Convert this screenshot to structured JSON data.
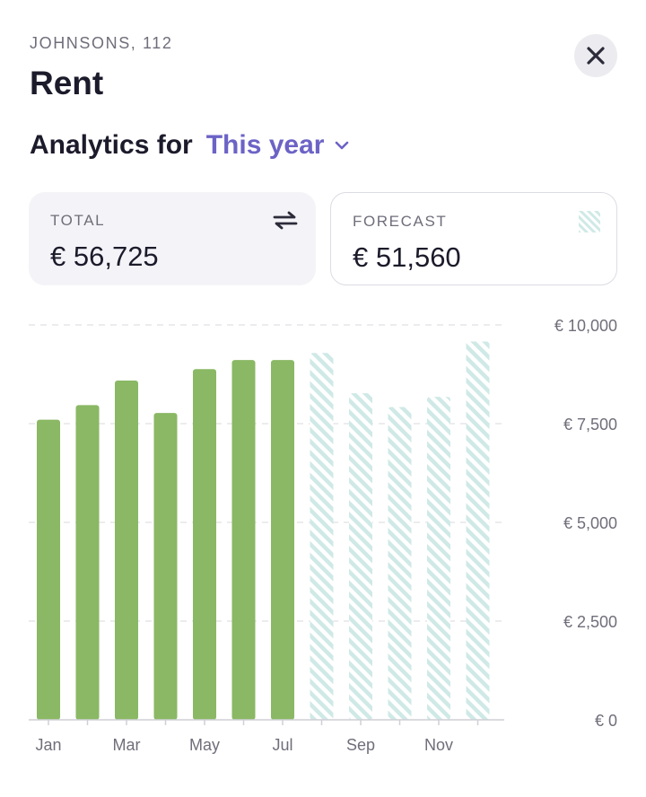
{
  "header": {
    "subtitle": "JOHNSONS, 112",
    "title": "Rent"
  },
  "analytics": {
    "label": "Analytics for",
    "period": "This year"
  },
  "cards": {
    "total": {
      "label": "TOTAL",
      "value": "€ 56,725"
    },
    "forecast": {
      "label": "FORECAST",
      "value": "€ 51,560"
    }
  },
  "colors": {
    "actual": "#8ab864",
    "forecast": "#cfe9e6",
    "accent": "#6c63c6"
  },
  "icons": {
    "close": "close-icon",
    "swap": "swap-arrows-icon",
    "forecast": "hatched-square-icon",
    "period": "chevron-down-icon"
  },
  "chart_data": {
    "type": "bar",
    "categories": [
      "Jan",
      "Feb",
      "Mar",
      "Apr",
      "May",
      "Jun",
      "Jul",
      "Aug",
      "Sep",
      "Oct",
      "Nov",
      "Dec"
    ],
    "x_tick_labels": [
      "Jan",
      "",
      "Mar",
      "",
      "May",
      "",
      "Jul",
      "",
      "Sep",
      "",
      "Nov",
      ""
    ],
    "series": [
      {
        "name": "TOTAL",
        "values": [
          7600,
          7970,
          8590,
          7770,
          8880,
          9110,
          9110,
          null,
          null,
          null,
          null,
          null
        ]
      },
      {
        "name": "FORECAST",
        "values": [
          null,
          null,
          null,
          null,
          null,
          null,
          null,
          9290,
          8270,
          7920,
          8180,
          9580
        ]
      }
    ],
    "y_ticks": [
      0,
      2500,
      5000,
      7500,
      10000
    ],
    "y_tick_labels": [
      "€ 0",
      "€ 2,500",
      "€ 5,000",
      "€ 7,500",
      "€ 10,000"
    ],
    "ylim": [
      0,
      10000
    ],
    "grid": true,
    "y_axis_side": "right"
  }
}
